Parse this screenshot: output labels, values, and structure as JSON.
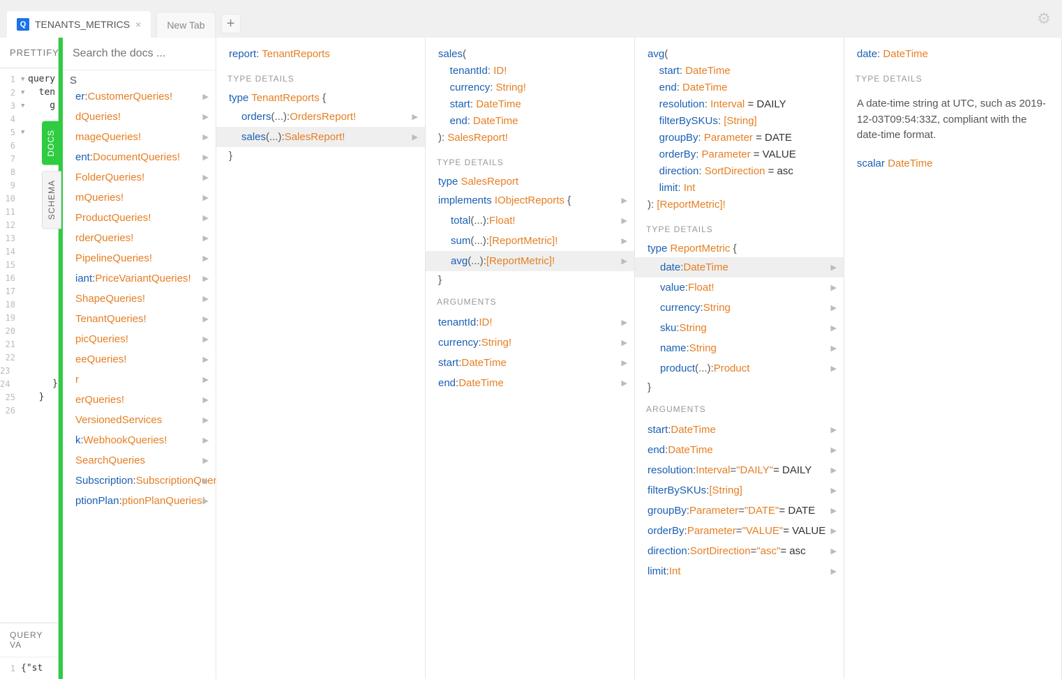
{
  "tabs": {
    "active": "TENANTS_METRICS",
    "inactive": "New Tab"
  },
  "toolbar": {
    "prettify": "PRETTIFY"
  },
  "editor": {
    "lines": [
      {
        "n": 1,
        "fold": "▼",
        "t": "query"
      },
      {
        "n": 2,
        "fold": "▼",
        "t": "  ten"
      },
      {
        "n": 3,
        "fold": "▼",
        "t": "    g"
      },
      {
        "n": 4,
        "fold": "",
        "t": ""
      },
      {
        "n": 5,
        "fold": "▼",
        "t": ""
      },
      {
        "n": 6,
        "fold": "",
        "t": ""
      },
      {
        "n": 7,
        "fold": "",
        "t": ""
      },
      {
        "n": 8,
        "fold": "",
        "t": ""
      },
      {
        "n": 9,
        "fold": "",
        "t": ""
      },
      {
        "n": 10,
        "fold": "",
        "t": ""
      },
      {
        "n": 11,
        "fold": "",
        "t": ""
      },
      {
        "n": 12,
        "fold": "",
        "t": ""
      },
      {
        "n": 13,
        "fold": "",
        "t": ""
      },
      {
        "n": 14,
        "fold": "",
        "t": ""
      },
      {
        "n": 15,
        "fold": "",
        "t": ""
      },
      {
        "n": 16,
        "fold": "",
        "t": ""
      },
      {
        "n": 17,
        "fold": "",
        "t": ""
      },
      {
        "n": 18,
        "fold": "",
        "t": ""
      },
      {
        "n": 19,
        "fold": "",
        "t": ""
      },
      {
        "n": 20,
        "fold": "",
        "t": ""
      },
      {
        "n": 21,
        "fold": "",
        "t": ""
      },
      {
        "n": 22,
        "fold": "",
        "t": ""
      },
      {
        "n": 23,
        "fold": "",
        "t": "        }"
      },
      {
        "n": 24,
        "fold": "",
        "t": "      }"
      },
      {
        "n": 25,
        "fold": "",
        "t": "  }"
      },
      {
        "n": 26,
        "fold": "",
        "t": ""
      }
    ]
  },
  "sidetabs": {
    "docs": "DOCS",
    "schema": "SCHEMA"
  },
  "qvars": {
    "label": "QUERY VA",
    "line": "{\"st"
  },
  "search": {
    "placeholder": "Search the docs ..."
  },
  "labels": {
    "typeDetails": "TYPE DETAILS",
    "arguments": "ARGUMENTS",
    "type": "type",
    "implements": "implements",
    "scalar": "scalar"
  },
  "suffix": "S",
  "col0": {
    "items": [
      {
        "f": "er",
        "t": "CustomerQueries!"
      },
      {
        "f": "",
        "t": "dQueries!"
      },
      {
        "f": "",
        "t": "mageQueries!"
      },
      {
        "f": "ent",
        "t": "DocumentQueries!"
      },
      {
        "f": "",
        "t": "FolderQueries!"
      },
      {
        "f": "",
        "t": "mQueries!"
      },
      {
        "f": "",
        "t": "ProductQueries!"
      },
      {
        "f": "",
        "t": "rderQueries!"
      },
      {
        "f": "",
        "t": "PipelineQueries!"
      },
      {
        "f": "iant",
        "t": "PriceVariantQueries!"
      },
      {
        "f": "",
        "t": "ShapeQueries!"
      },
      {
        "f": "",
        "t": "TenantQueries!"
      },
      {
        "f": "",
        "t": "picQueries!"
      },
      {
        "f": "",
        "t": "eeQueries!"
      },
      {
        "f": "",
        "t": "r"
      },
      {
        "f": "",
        "t": "erQueries!"
      },
      {
        "f": "",
        "t": "VersionedServices"
      },
      {
        "f": "k",
        "t": "WebhookQueries!"
      },
      {
        "f": "",
        "t": "SearchQueries"
      }
    ],
    "subs": [
      {
        "f": "Subscription",
        "t": "SubscriptionQueries!"
      },
      {
        "f": "ptionPlan",
        "t": "ptionPlanQueries!"
      }
    ]
  },
  "col1": {
    "sigField": "report",
    "sigType": "TenantReports",
    "typeName": "TenantReports",
    "fields": [
      {
        "name": "orders",
        "args": "(...)",
        "ret": "OrdersReport!",
        "active": false
      },
      {
        "name": "sales",
        "args": "(...)",
        "ret": "SalesReport!",
        "active": true
      }
    ]
  },
  "col2": {
    "sigField": "sales",
    "sigArgs": [
      {
        "n": "tenantId",
        "t": "ID!"
      },
      {
        "n": "currency",
        "t": "String!"
      },
      {
        "n": "start",
        "t": "DateTime"
      },
      {
        "n": "end",
        "t": "DateTime"
      }
    ],
    "sigRet": "SalesReport!",
    "typeName": "SalesReport",
    "implements": "IObjectReports",
    "fields": [
      {
        "name": "total",
        "args": "(...)",
        "ret": "Float!",
        "active": false
      },
      {
        "name": "sum",
        "args": "(...)",
        "ret": "[ReportMetric]!",
        "active": false
      },
      {
        "name": "avg",
        "args": "(...)",
        "ret": "[ReportMetric]!",
        "active": true
      }
    ],
    "closeBrace": "}",
    "args": [
      {
        "n": "tenantId",
        "t": "ID!"
      },
      {
        "n": "currency",
        "t": "String!"
      },
      {
        "n": "start",
        "t": "DateTime"
      },
      {
        "n": "end",
        "t": "DateTime"
      }
    ]
  },
  "col3": {
    "sigField": "avg",
    "sigArgs": [
      {
        "n": "start",
        "t": "DateTime"
      },
      {
        "n": "end",
        "t": "DateTime"
      },
      {
        "n": "resolution",
        "t": "Interval",
        "d": "DAILY"
      },
      {
        "n": "filterBySKUs",
        "t": "[String]"
      },
      {
        "n": "groupBy",
        "t": "Parameter",
        "d": "DATE"
      },
      {
        "n": "orderBy",
        "t": "Parameter",
        "d": "VALUE"
      },
      {
        "n": "direction",
        "t": "SortDirection",
        "d": "asc"
      },
      {
        "n": "limit",
        "t": "Int"
      }
    ],
    "sigRet": "[ReportMetric]!",
    "typeName": "ReportMetric",
    "fields": [
      {
        "name": "date",
        "ret": "DateTime",
        "active": true
      },
      {
        "name": "value",
        "ret": "Float!",
        "active": false
      },
      {
        "name": "currency",
        "ret": "String",
        "active": false
      },
      {
        "name": "sku",
        "ret": "String",
        "active": false
      },
      {
        "name": "name",
        "ret": "String",
        "active": false
      },
      {
        "name": "product",
        "args": "(...)",
        "ret": "Product",
        "active": false
      }
    ],
    "closeBrace": "}",
    "args": [
      {
        "n": "start",
        "t": "DateTime"
      },
      {
        "n": "end",
        "t": "DateTime"
      },
      {
        "n": "resolution",
        "t": "Interval",
        "dq": "\"DAILY\"",
        "d": "DAILY"
      },
      {
        "n": "filterBySKUs",
        "t": "[String]"
      },
      {
        "n": "groupBy",
        "t": "Parameter",
        "dq": "\"DATE\"",
        "d": "DATE"
      },
      {
        "n": "orderBy",
        "t": "Parameter",
        "dq": "\"VALUE\"",
        "d": "VALUE"
      },
      {
        "n": "direction",
        "t": "SortDirection",
        "dq": "\"asc\"",
        "d": "asc"
      },
      {
        "n": "limit",
        "t": "Int"
      }
    ]
  },
  "col4": {
    "sigField": "date",
    "sigType": "DateTime",
    "desc": "A date-time string at UTC, such as 2019-12-03T09:54:33Z, compliant with the date-time format.",
    "scalarName": "DateTime"
  }
}
